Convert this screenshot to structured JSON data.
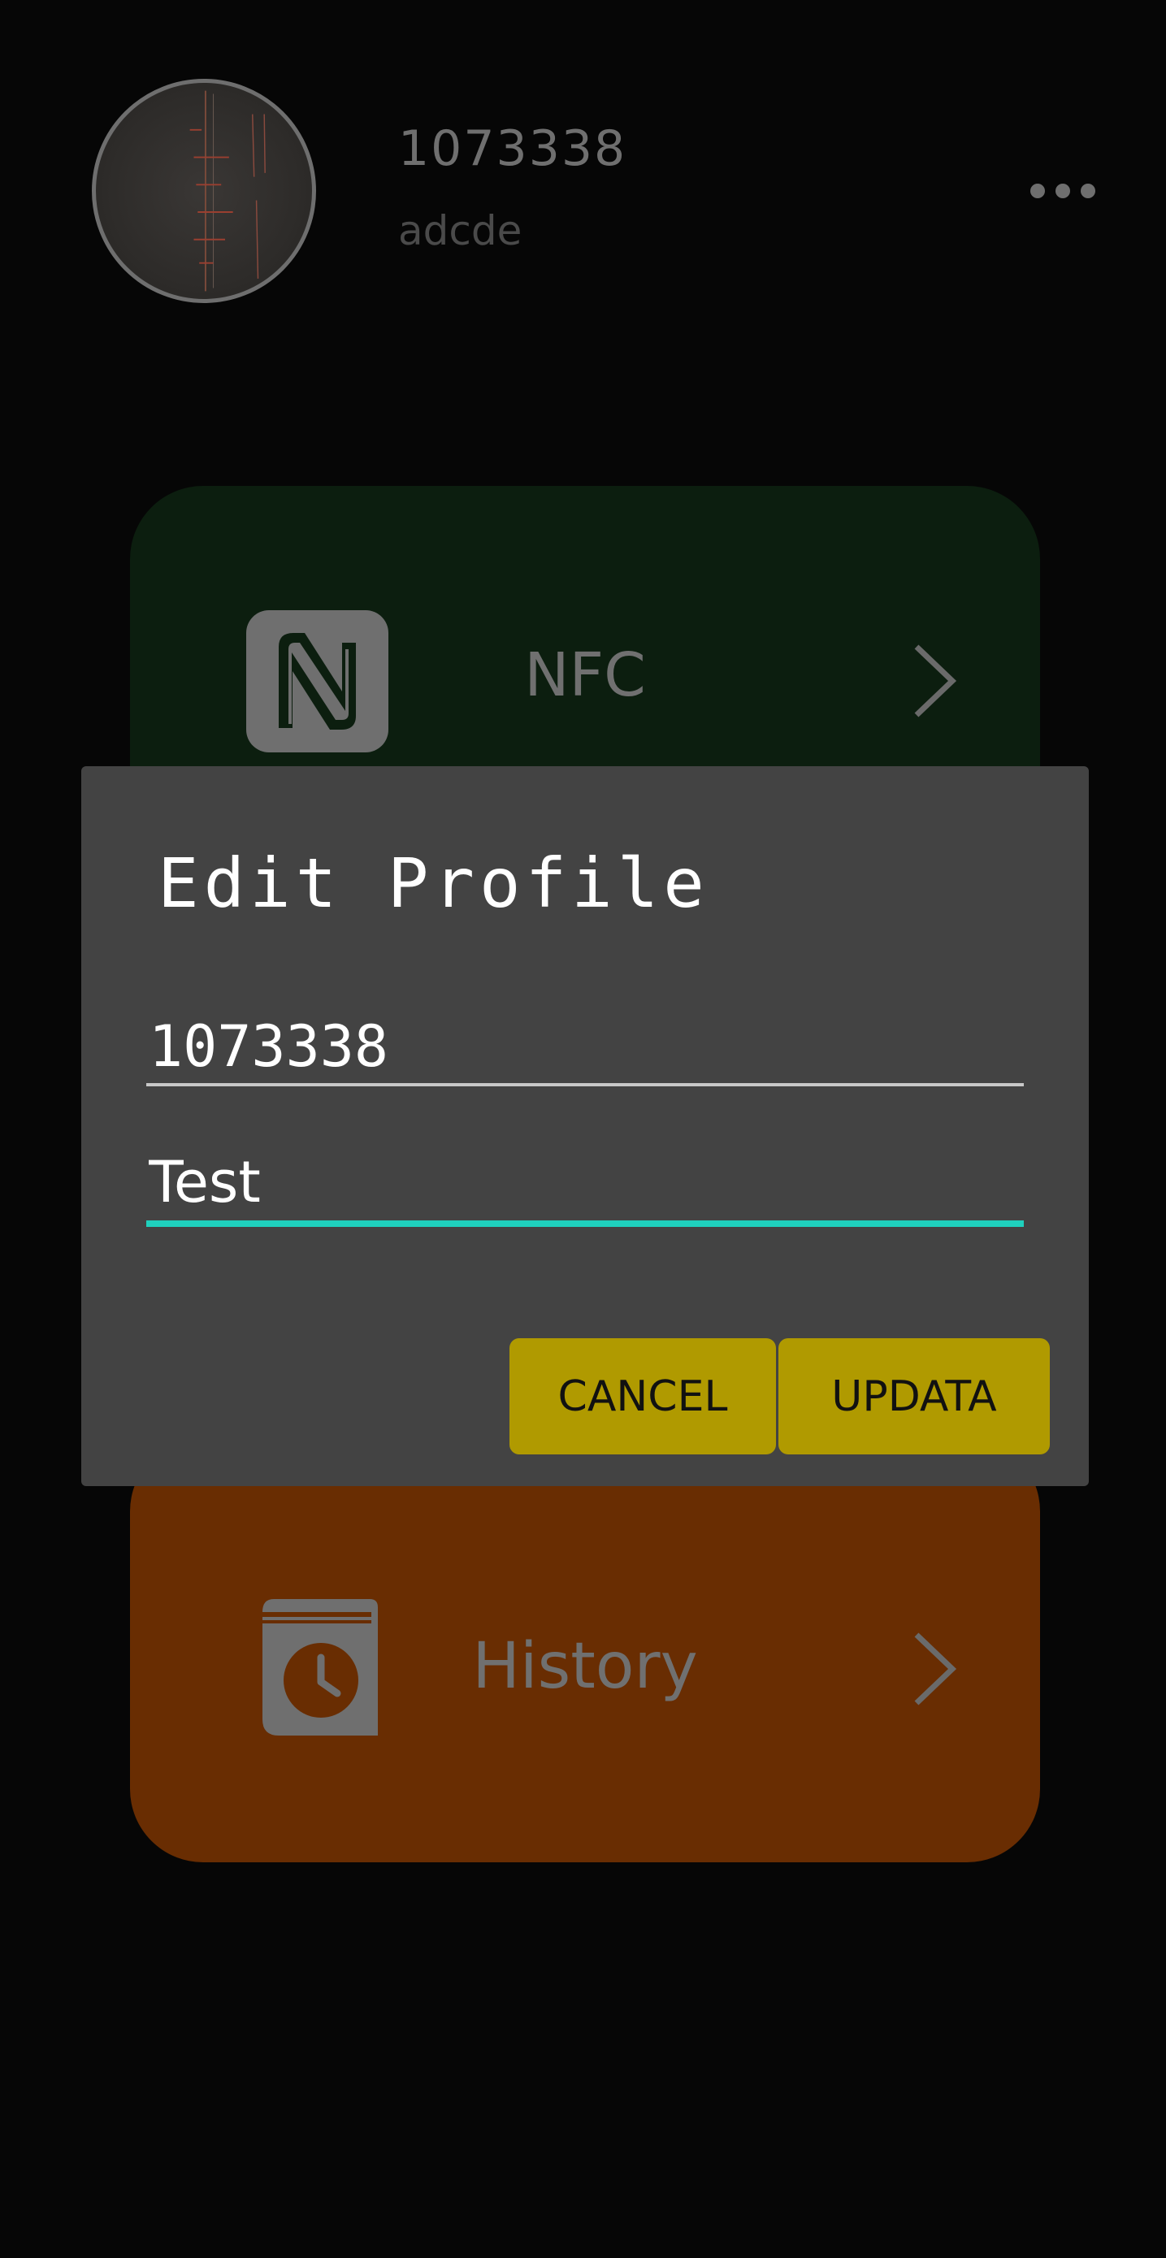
{
  "header": {
    "user_id": "1073338",
    "user_name": "adcde",
    "avatar_icon": "profile-photo",
    "more_icon": "more-dots-icon"
  },
  "cards": {
    "nfc": {
      "label": "NFC",
      "icon": "nfc-icon",
      "color": "#0c1e0f"
    },
    "history": {
      "label": "History",
      "icon": "history-book-icon",
      "color": "#692d02"
    }
  },
  "dialog": {
    "title": "Edit Profile",
    "id_field_value": "1073338",
    "name_field_value": "Test",
    "cancel_label": "CANCEL",
    "update_label": "UPDATA",
    "accent_color": "#1fd0bd",
    "button_color": "#b09a00"
  }
}
